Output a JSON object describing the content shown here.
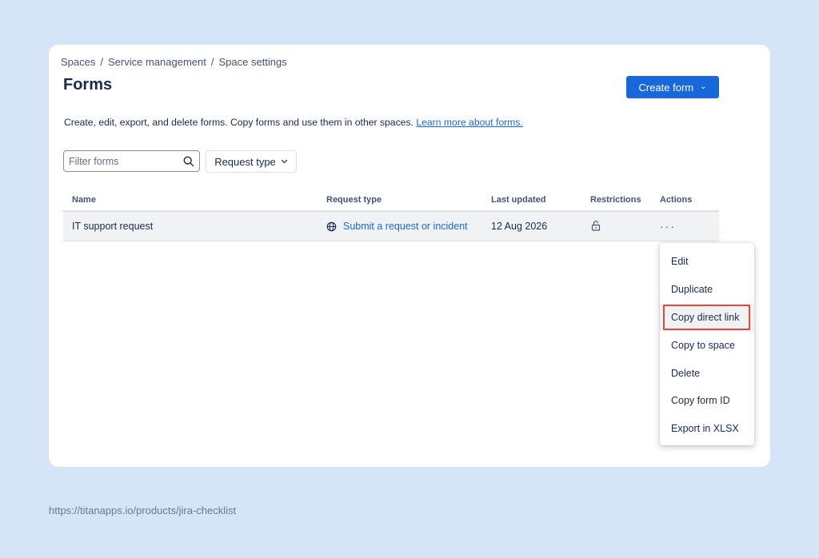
{
  "breadcrumb": [
    "Spaces",
    "Service management",
    "Space settings"
  ],
  "breadcrumb_separator": "/",
  "page": {
    "title": "Forms",
    "create_button": "Create form",
    "description": "Create, edit, export, and delete forms. Copy forms and use them in other spaces.",
    "learn_more": "Learn more about forms."
  },
  "filters": {
    "search_placeholder": "Filter forms",
    "request_type_label": "Request type"
  },
  "table": {
    "headers": [
      "Name",
      "Request type",
      "Last updated",
      "Restrictions",
      "Actions"
    ],
    "rows": [
      {
        "name": "IT support request",
        "request_type": "Submit a request or incident",
        "last_updated": "12 Aug 2026",
        "restrictions_icon": "unlock-icon",
        "actions_icon": "more-icon"
      }
    ]
  },
  "actions_menu": {
    "items": [
      "Edit",
      "Duplicate",
      "Copy direct link",
      "Copy to space",
      "Delete",
      "Copy form ID",
      "Export in XLSX"
    ],
    "highlighted_index": 2,
    "highlight_color": "#e2483d"
  },
  "footer_url": "https://titanapps.io/products/jira-checklist",
  "colors": {
    "background": "#d6e4f8",
    "primary": "#1868db",
    "card": "#ffffff"
  }
}
